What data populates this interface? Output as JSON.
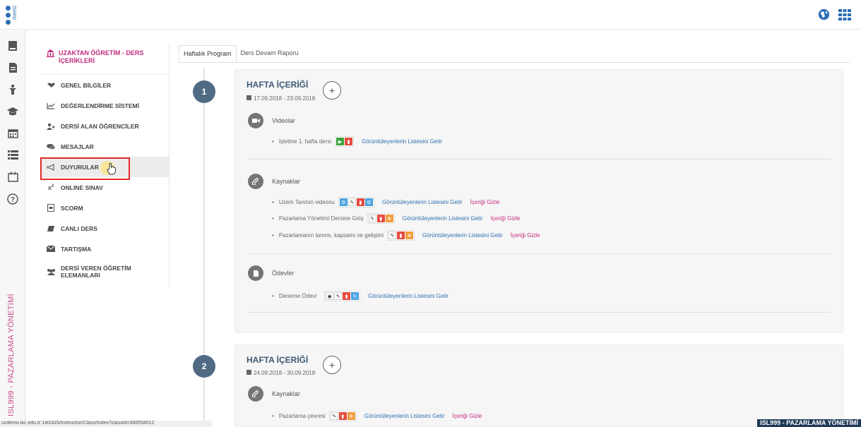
{
  "topbar": {
    "menu_label": "menü"
  },
  "sidebar_vertical_title": "ISL999 - PAZARLAMA YÖNETİMİ",
  "left_menu": {
    "header": "UZAKTAN ÖĞRETİM - DERS İÇERİKLERİ",
    "items": [
      {
        "label": "GENEL BİLGİLER",
        "icon": "handshake-icon"
      },
      {
        "label": "DEĞERLENDİRME SİSTEMİ",
        "icon": "chart-line-icon"
      },
      {
        "label": "DERSİ ALAN ÖĞRENCİLER",
        "icon": "users-add-icon"
      },
      {
        "label": "MESAJLAR",
        "icon": "chat-icon"
      },
      {
        "label": "DUYURULAR",
        "icon": "megaphone-icon"
      },
      {
        "label": "ONLINE SINAV",
        "icon": "x-squared-icon"
      },
      {
        "label": "SCORM",
        "icon": "scorm-icon"
      },
      {
        "label": "CANLI DERS",
        "icon": "book-icon"
      },
      {
        "label": "TARTIŞMA",
        "icon": "envelope-icon"
      },
      {
        "label": "DERSİ VEREN ÖĞRETİM ELEMANLARI",
        "icon": "group-icon"
      }
    ]
  },
  "tabs": [
    "Haftalık Program",
    "Ders Devam Raporu"
  ],
  "weeks": [
    {
      "num": "1",
      "title": "HAFTA İÇERİĞİ",
      "date": "17.09.2018 - 23.09.2018",
      "sections": [
        {
          "title": "Videolar",
          "items": [
            {
              "text": "İşletme 1. hafta dersi",
              "link": "Görüntüleyenlerin Listesini Getir"
            }
          ]
        },
        {
          "title": "Kaynaklar",
          "items": [
            {
              "text": "Uzem Tanıtım videosu",
              "link": "Görüntüleyenlerin Listesini Getir",
              "link2": "İçeriği Gizle"
            },
            {
              "text": "Pazarlama Yönetimi Dersine Giriş",
              "link": "Görüntüleyenlerin Listesini Getir",
              "link2": "İçeriği Gizle"
            },
            {
              "text": "Pazarlamanın tanımı, kapsamı ve gelişimi",
              "link": "Görüntüleyenlerin Listesini Getir",
              "link2": "İçeriği Gizle"
            }
          ]
        },
        {
          "title": "Ödevler",
          "items": [
            {
              "text": "Deneme Ödevi",
              "link": "Görüntüleyenlerin Listesini Getir"
            }
          ]
        }
      ]
    },
    {
      "num": "2",
      "title": "HAFTA İÇERİĞİ",
      "date": "24.09.2018 - 30.09.2018",
      "sections": [
        {
          "title": "Kaynaklar",
          "items": [
            {
              "text": "Pazarlama çevresi",
              "link": "Görüntüleyenlerin Listesini Getir",
              "link2": "İçeriği Gizle"
            }
          ]
        }
      ]
    }
  ],
  "status_url": "uzdemo.ikc.edu.tr:140/AIS/Instructor/Class/Index?classId=36655#012",
  "footer_badge": "ISL999 - PAZARLAMA YÖNETİMİ",
  "colors": {
    "accent": "#c22a7a",
    "link": "#2f6fb0",
    "timeline_num": "#506a84",
    "highlight": "#e52a2a"
  }
}
